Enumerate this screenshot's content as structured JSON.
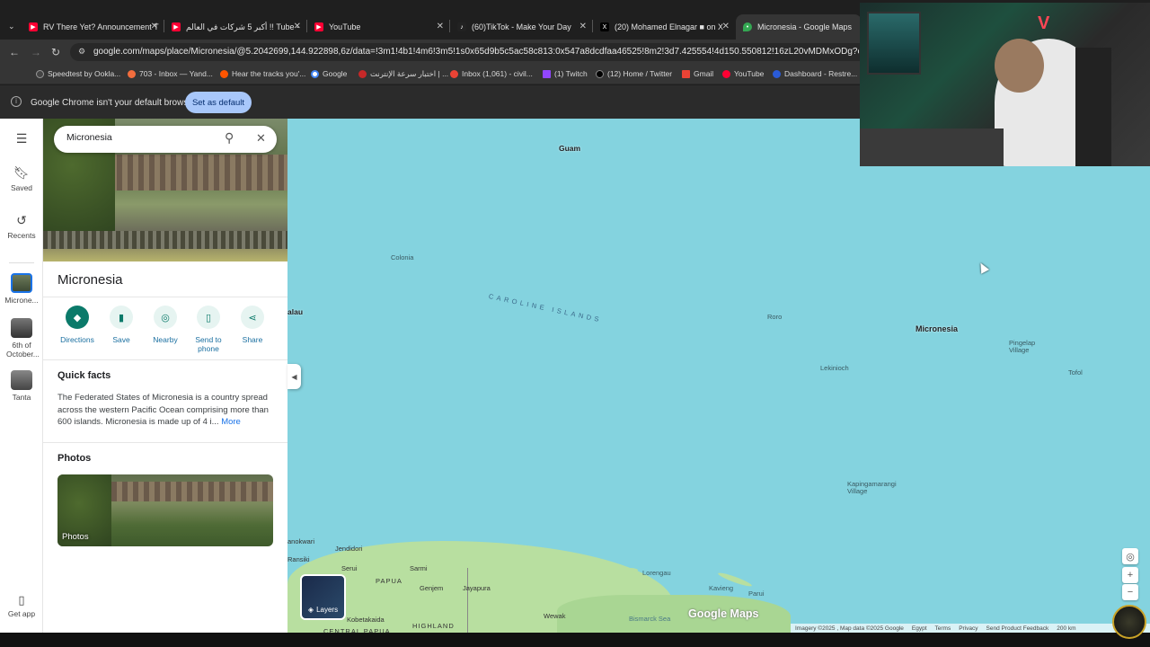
{
  "browser": {
    "tabs": [
      {
        "title": "RV There Yet? Announcement T",
        "fav_color": "#ff0033",
        "fav": "▶"
      },
      {
        "title": "أكبر 5 شركات في العالم !! Tube -",
        "fav_color": "#ff0033",
        "fav": "▶"
      },
      {
        "title": "YouTube",
        "fav_color": "#ff0033",
        "fav": "▶"
      },
      {
        "title": "(60)TikTok - Make Your Day",
        "fav_color": "#222222",
        "fav": "♪"
      },
      {
        "title": "(20) Mohamed Elnagar ■ on X",
        "fav_color": "#000000",
        "fav": "X"
      },
      {
        "title": "Micronesia - Google Maps",
        "fav_color": "#34a853",
        "fav": "⬤"
      }
    ],
    "url": "google.com/maps/place/Micronesia/@5.2042699,144.922898,6z/data=!3m1!4b1!4m6!3m5!1s0x65d9b5c5ac58c813:0x547a8dcdfaa46525!8m2!3d7.425554!4d150.550812!16zL20vMDMxODg?entry=ttu&g_ep=",
    "bookmarks": [
      {
        "label": "Speedtest by Ookla...",
        "color": "#333333"
      },
      {
        "label": "703 - Inbox — Yand...",
        "color": "#f26d3d"
      },
      {
        "label": "Hear the tracks you'...",
        "color": "#ff5500"
      },
      {
        "label": "Google",
        "color": "#4285f4"
      },
      {
        "label": "اختبار سرعة الإنترنت | ...",
        "color": "#c62828"
      },
      {
        "label": "Inbox (1,061) - civil...",
        "color": "#ea4335"
      },
      {
        "label": "(1) Twitch",
        "color": "#9146ff"
      },
      {
        "label": "(12) Home / Twitter",
        "color": "#000000"
      },
      {
        "label": "Gmail",
        "color": "#ea4335"
      },
      {
        "label": "YouTube",
        "color": "#ff0033"
      },
      {
        "label": "Dashboard - Restre...",
        "color": "#2a5bd7"
      }
    ],
    "infobar_text": "Google Chrome isn't your default browser",
    "set_default_label": "Set as default"
  },
  "rail": {
    "saved": "Saved",
    "recents": "Recents",
    "recent_items": [
      "Microne...",
      "6th of October...",
      "Tanta"
    ],
    "get_app": "Get app"
  },
  "panel": {
    "search_value": "Micronesia",
    "title": "Micronesia",
    "actions": [
      "Directions",
      "Save",
      "Nearby",
      "Send to phone",
      "Share"
    ],
    "quick_facts_title": "Quick facts",
    "quick_facts_text": "The Federated States of Micronesia is a country spread across the western Pacific Ocean comprising more than 600 islands. Micronesia is made up of 4 i...",
    "more_label": "More",
    "photos_title": "Photos",
    "photos_label": "Photos"
  },
  "map": {
    "labels": {
      "guam": "Guam",
      "colonia": "Colonia",
      "palau": "alau",
      "caroline": "CAROLINE ISLANDS",
      "roro": "Roro",
      "micronesia": "Micronesia",
      "pingelap": "Pingelap Village",
      "tofol": "Tofol",
      "lekinioch": "Lekinioch",
      "kapinga": "Kapingamarangi Village",
      "manokwari": "anokwari",
      "jendidori": "Jendidori",
      "sarmi": "Sarmi",
      "rsiki": "Ransiki",
      "serui": "Serui",
      "papua": "PAPUA",
      "genjem": "Genjem",
      "jayapura": "Jayapura",
      "lorengau": "Lorengau",
      "kavieng": "Kavieng",
      "parui": "Parui",
      "kobetakaida": "Kobetakaida",
      "highland": "HIGHLAND",
      "central": "CENTRAL PAPUA",
      "wewak": "Wewak",
      "bismarck": "Bismarck Sea"
    },
    "layers_label": "Layers",
    "brand": "Google Maps",
    "footer": [
      "Imagery ©2025 , Map data ©2025 Google",
      "Egypt",
      "Terms",
      "Privacy",
      "Send Product Feedback",
      "200 km"
    ]
  }
}
